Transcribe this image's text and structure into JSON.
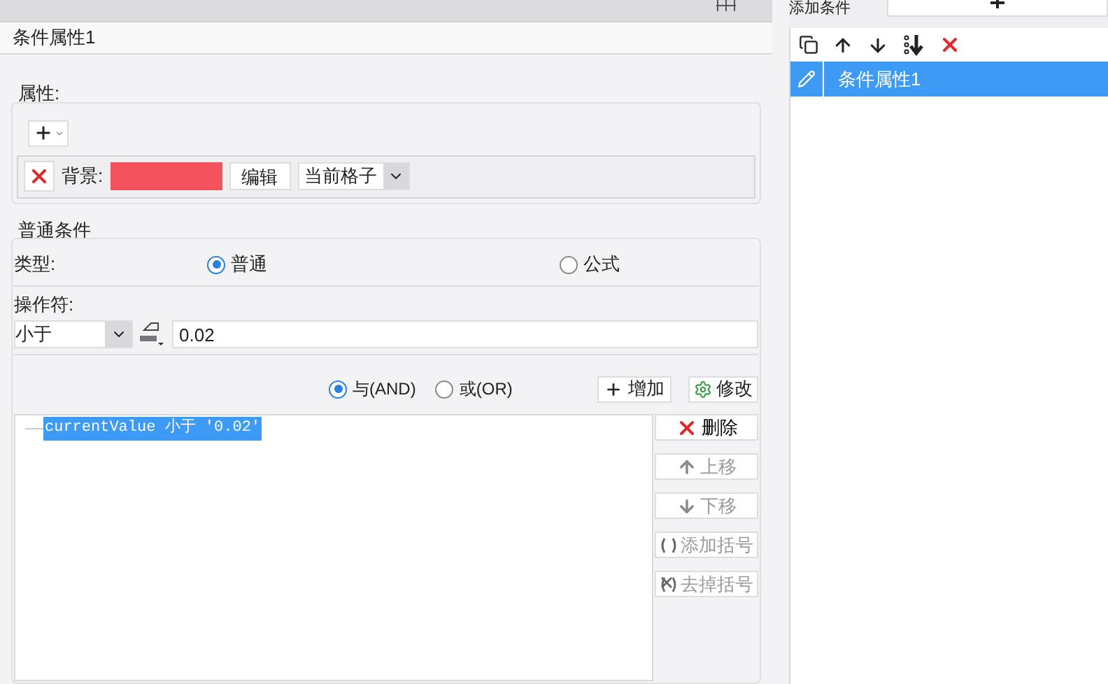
{
  "top_bar": {
    "add_condition_label": "添加条件"
  },
  "header": {
    "title": "条件属性1"
  },
  "properties": {
    "legend": "属性:",
    "items": [
      {
        "label": "背景:",
        "color": "#f4525c",
        "edit_button": "编辑",
        "scope": "当前格子"
      }
    ]
  },
  "condition": {
    "legend": "普通条件",
    "type_label": "类型:",
    "types": [
      {
        "label": "普通",
        "selected": true
      },
      {
        "label": "公式",
        "selected": false
      }
    ],
    "operator_label": "操作符:",
    "operator": "小于",
    "value": "0.02",
    "joins": [
      {
        "label": "与(AND)",
        "selected": true
      },
      {
        "label": "或(OR)",
        "selected": false
      }
    ],
    "add_button": "增加",
    "modify_button": "修改",
    "expressions": [
      {
        "text": "currentValue 小于 '0.02'",
        "selected": true
      }
    ],
    "actions": [
      {
        "kind": "delete",
        "label": "删除",
        "disabled": false
      },
      {
        "kind": "up",
        "label": "上移",
        "disabled": true
      },
      {
        "kind": "down",
        "label": "下移",
        "disabled": true
      },
      {
        "kind": "add_brackets",
        "label": "添加括号",
        "disabled": true
      },
      {
        "kind": "remove_brackets",
        "label": "去掉括号",
        "disabled": true
      }
    ]
  },
  "conditions_list": {
    "items": [
      {
        "label": "条件属性1",
        "selected": true
      }
    ]
  }
}
